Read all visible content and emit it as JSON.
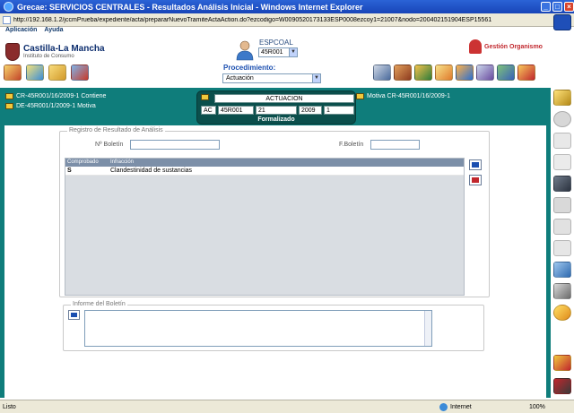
{
  "window": {
    "title": "Grecae: SERVICIOS CENTRALES - Resultados Análisis Inicial - Windows Internet Explorer",
    "url": "http://192.168.1.2/jccmPrueba/expediente/acta/prepararNuevoTramiteActaAction.do?ezcodigo=W0090520173133ESP0008ezcoy1=21007&nodo=200402151904ESP15561"
  },
  "app_menu": {
    "items": [
      "Aplicación",
      "Ayuda"
    ]
  },
  "header": {
    "brand": "Castilla-La Mancha",
    "brand_sub": "Instituto de Consumo",
    "espcoal_label": "ESPCOAL",
    "espcoal_value": "45R001",
    "gestion_label": "Gestión Organismo",
    "procedimiento_label": "Procedimiento:",
    "procedimiento_value": "Actuación"
  },
  "context": {
    "line1": "CR-45R001/16/2009-1 Contiene",
    "line2": "DE-45R001/1/2009-1   Motiva",
    "line3": "Motiva CR-45R001/16/2009-1"
  },
  "actuacion": {
    "title": "ACTUACION",
    "cells": [
      "AC",
      "45R001",
      "21",
      "2009",
      "1"
    ],
    "status": "Formalizado"
  },
  "registro": {
    "legend": "Registro de Resultado de Análisis",
    "boletin_label": "Nº Boletín",
    "boletin_value": "",
    "fecha_label": "F.Boletín",
    "fecha_value": ""
  },
  "grid": {
    "columns": [
      "Comprobado",
      "Infracción"
    ],
    "rows": [
      {
        "comprobado": "S",
        "infraccion": "Clandestinidad de sustancias"
      }
    ]
  },
  "informe": {
    "legend": "Informe del Boletín",
    "text": ""
  },
  "statusbar": {
    "ready": "Listo",
    "zone": "Internet",
    "zoom": "100%"
  },
  "colors": {
    "teal": "#0f7d7b",
    "dark_teal": "#0b4f4c",
    "brand_blue": "#0c2d6e",
    "accent_red": "#c1272d"
  }
}
